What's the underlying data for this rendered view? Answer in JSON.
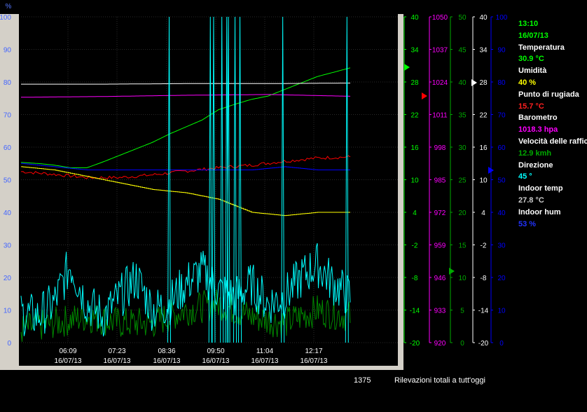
{
  "chart_data": {
    "type": "line",
    "x_ticks": [
      {
        "time": "06:09",
        "date": "16/07/13"
      },
      {
        "time": "07:23",
        "date": "16/07/13"
      },
      {
        "time": "08:36",
        "date": "16/07/13"
      },
      {
        "time": "09:50",
        "date": "16/07/13"
      },
      {
        "time": "11:04",
        "date": "16/07/13"
      },
      {
        "time": "12:17",
        "date": "16/07/13"
      }
    ],
    "left_axis": {
      "unit": "%",
      "range": [
        0,
        100
      ],
      "ticks": [
        0,
        10,
        20,
        30,
        40,
        50,
        60,
        70,
        80,
        90,
        100
      ]
    },
    "right_axes": [
      {
        "name": "temperature",
        "color": "#00ff00",
        "range": [
          -20,
          40
        ],
        "ticks": [
          -20,
          -14,
          -8,
          -2,
          4,
          10,
          16,
          22,
          28,
          34,
          40
        ]
      },
      {
        "name": "pressure",
        "color": "#ff00ff",
        "range": [
          920,
          1050
        ],
        "ticks": [
          920,
          933,
          946,
          959,
          972,
          985,
          998,
          1011,
          1024,
          1037,
          1050
        ]
      },
      {
        "name": "wind_speed",
        "color": "#00aa00",
        "range": [
          0,
          50
        ],
        "ticks": [
          0,
          5,
          10,
          15,
          20,
          25,
          30,
          35,
          40,
          45,
          50
        ]
      },
      {
        "name": "indoor_temp",
        "color": "#ffffff",
        "range": [
          -20,
          40
        ],
        "ticks": [
          -20,
          -14,
          -8,
          -2,
          4,
          10,
          16,
          22,
          28,
          34,
          40
        ]
      },
      {
        "name": "indoor_hum",
        "color": "#0000ff",
        "range": [
          0,
          100
        ],
        "ticks": [
          0,
          10,
          20,
          30,
          40,
          50,
          60,
          70,
          80,
          90,
          100
        ]
      }
    ],
    "series": [
      {
        "color": "#00ff00",
        "axis": "temperature",
        "x": [
          0,
          0.05,
          0.1,
          0.15,
          0.2,
          0.25,
          0.3,
          0.35,
          0.4,
          0.45,
          0.5,
          0.55,
          0.6,
          0.65,
          0.7,
          0.75,
          0.8,
          0.85,
          0.9,
          0.95,
          1
        ],
        "y": [
          13.2,
          13.0,
          12.7,
          12.2,
          12.2,
          13.3,
          14.5,
          15.7,
          16.9,
          18.4,
          19.7,
          21.0,
          22.9,
          23.9,
          24.8,
          25.4,
          26.6,
          27.8,
          29.0,
          29.8,
          30.6
        ]
      },
      {
        "color": "#ff00ff",
        "axis": "pressure",
        "x": [
          0,
          0.25,
          0.5,
          0.75,
          1
        ],
        "y": [
          1017.9,
          1018.2,
          1018.7,
          1019.0,
          1018.3
        ]
      },
      {
        "color": "#ffffff",
        "axis": "indoor_temp",
        "x": [
          0,
          0.25,
          0.5,
          0.75,
          1
        ],
        "y": [
          27.6,
          27.6,
          27.7,
          27.7,
          27.8
        ]
      },
      {
        "color": "#ff0000",
        "axis": "temperature",
        "x": [
          0,
          0.1,
          0.2,
          0.3,
          0.4,
          0.5,
          0.6,
          0.7,
          0.8,
          0.9,
          1
        ],
        "y": [
          11.5,
          11.0,
          10.4,
          10.4,
          10.9,
          11.6,
          12.2,
          12.7,
          13.4,
          14.0,
          14.2
        ]
      },
      {
        "color": "#0000ff",
        "axis": "indoor_hum",
        "x": [
          0,
          0.1,
          0.2,
          0.3,
          0.4,
          0.5,
          0.6,
          0.7,
          0.8,
          0.9,
          1
        ],
        "y": [
          55,
          54,
          53,
          53,
          53,
          53,
          53,
          53,
          54,
          53,
          53
        ]
      },
      {
        "color": "#ffff00",
        "axis": "humidity",
        "x": [
          0,
          0.1,
          0.2,
          0.3,
          0.4,
          0.5,
          0.6,
          0.7,
          0.8,
          0.9,
          1
        ],
        "y": [
          54,
          53,
          51,
          49,
          47,
          46,
          44,
          40,
          39,
          40,
          40
        ]
      },
      {
        "color": "#008800",
        "axis": "wind_speed",
        "x": [
          0,
          0.1,
          0.2,
          0.3,
          0.4,
          0.5,
          0.6,
          0.7,
          0.8,
          0.9,
          1
        ],
        "y": [
          2,
          3,
          4,
          3,
          3,
          5,
          6,
          4,
          3,
          5,
          4
        ]
      },
      {
        "color": "#00ffff",
        "axis": "direction",
        "x": [
          0,
          0.05,
          0.1,
          0.15,
          0.2,
          0.25,
          0.3,
          0.35,
          0.4,
          0.45,
          0.5,
          0.55,
          0.6,
          0.65,
          0.7,
          0.75,
          0.8,
          0.85,
          0.9,
          0.95,
          1
        ],
        "y": [
          9,
          8,
          12,
          24,
          12,
          8,
          14,
          20,
          10,
          12,
          18,
          22,
          16,
          14,
          18,
          12,
          14,
          20,
          24,
          18,
          14
        ]
      }
    ],
    "spikes_percent_x": [
      0.45,
      0.575,
      0.585,
      0.61,
      0.625,
      0.63,
      0.65,
      0.665,
      0.795,
      0.99
    ],
    "grid": true
  },
  "panel": {
    "time": "13:10",
    "date": "16/07/13",
    "items": [
      {
        "label": "Temperatura",
        "value": "30.9 °C",
        "color": "#00ff00"
      },
      {
        "label": "Umidità",
        "value": "40 %",
        "color": "#ffff00"
      },
      {
        "label": "Punto di rugiada",
        "value": "15.7 °C",
        "color": "#ff0000"
      },
      {
        "label": "Barometro",
        "value": "1018.3 hpa",
        "color": "#ff00ff"
      },
      {
        "label": "Velocità delle raffiche",
        "value": "12.9 kmh",
        "color": "#00aa00"
      },
      {
        "label": "Direzione",
        "value": "45 °",
        "color": "#00ffff"
      },
      {
        "label": "Indoor temp",
        "value": "27.8 °C",
        "color": "#cccccc"
      },
      {
        "label": "Indoor hum",
        "value": "53 %",
        "color": "#0000ff"
      }
    ]
  },
  "footer": {
    "count": "1375",
    "text": "Rilevazioni totali a tutt'oggi"
  }
}
